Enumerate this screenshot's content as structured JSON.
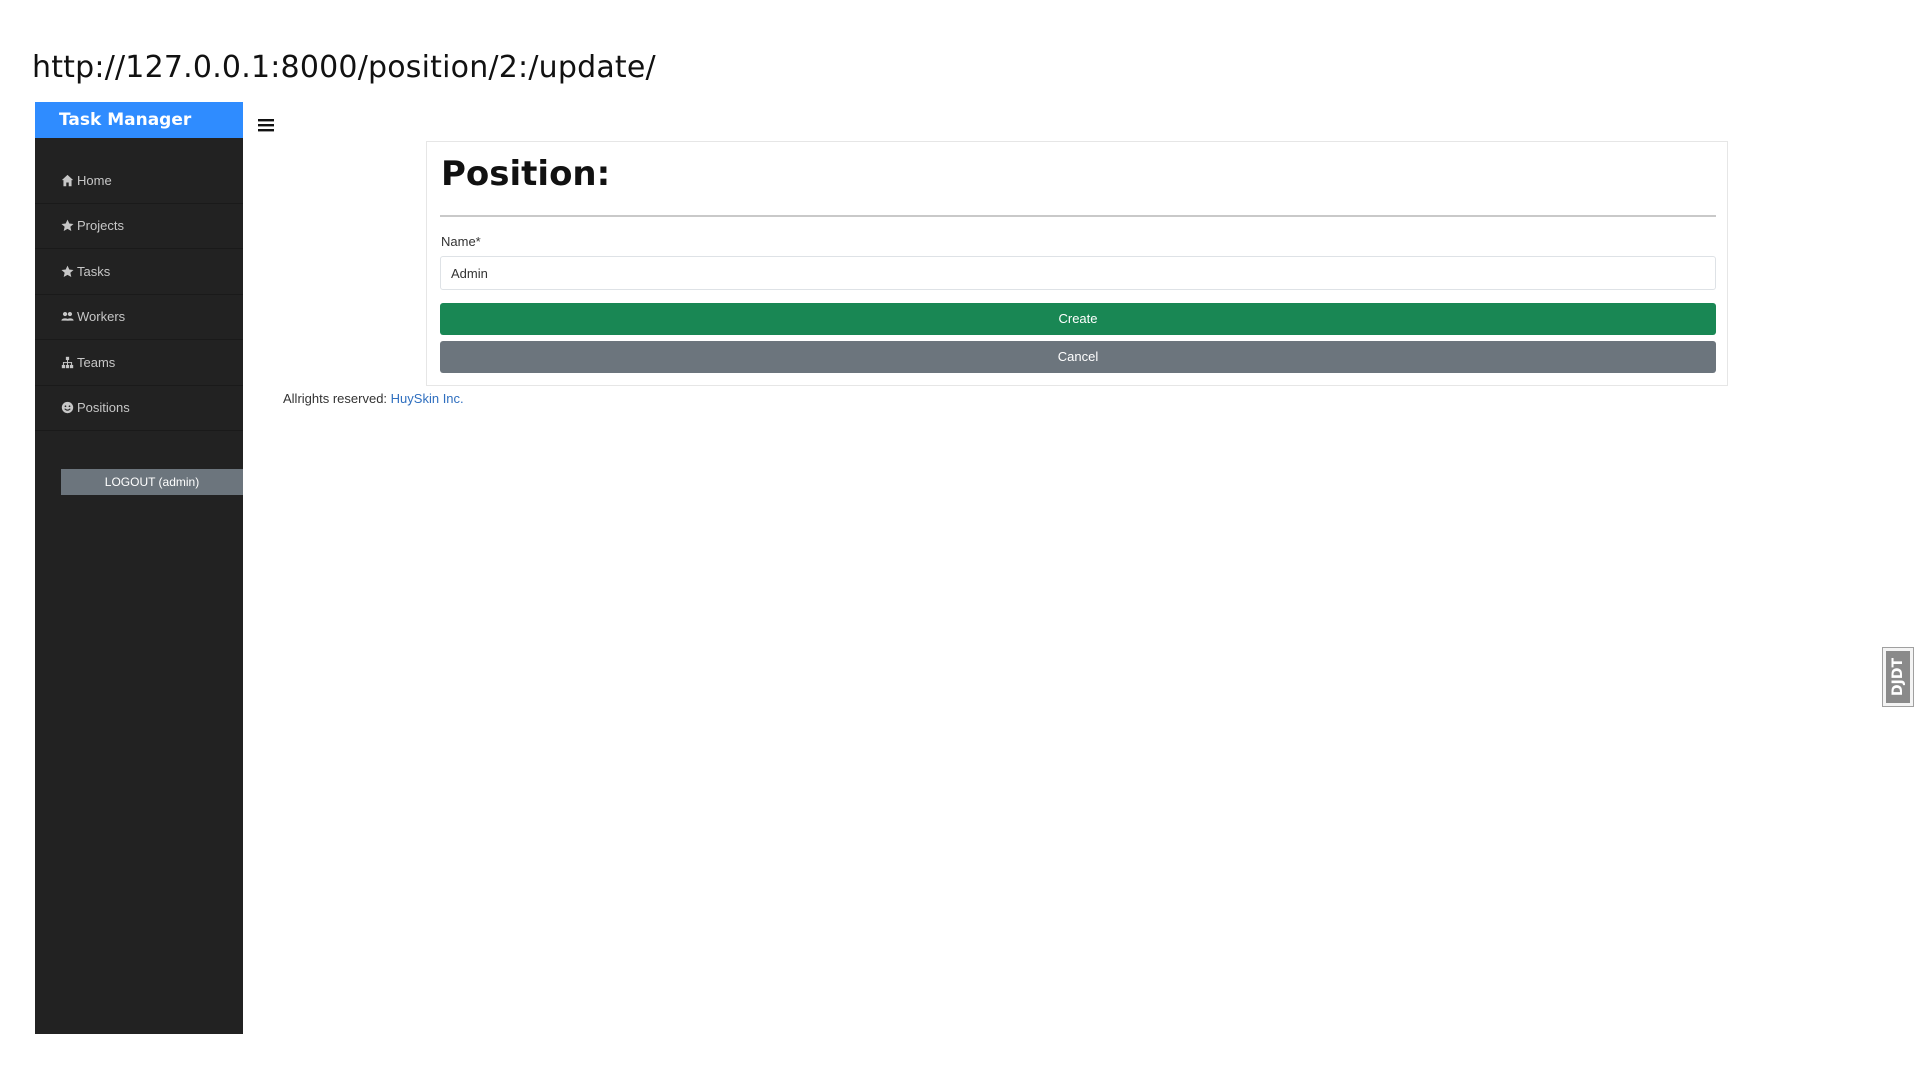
{
  "url": "http://127.0.0.1:8000/position/2:/update/",
  "sidebar": {
    "brand": "Task Manager",
    "items": [
      {
        "label": "Home",
        "icon": "home-icon"
      },
      {
        "label": "Projects",
        "icon": "star-icon"
      },
      {
        "label": "Tasks",
        "icon": "star-icon"
      },
      {
        "label": "Workers",
        "icon": "users-icon"
      },
      {
        "label": "Teams",
        "icon": "sitemap-icon"
      },
      {
        "label": "Positions",
        "icon": "face-icon"
      }
    ],
    "logout_label": "LOGOUT (admin)"
  },
  "header": {
    "menu_icon": "hamburger-icon"
  },
  "form": {
    "title": "Position:",
    "name_label": "Name*",
    "name_value": "Admin",
    "create_label": "Create",
    "cancel_label": "Cancel"
  },
  "footer": {
    "text": "Allrights reserved:",
    "link_text": "HuySkin Inc."
  },
  "debug_toolbar": {
    "label": "DJDT"
  },
  "colors": {
    "brand": "#2f8cff",
    "sidebar_bg": "#222222",
    "create": "#198754",
    "cancel": "#6c757d"
  }
}
